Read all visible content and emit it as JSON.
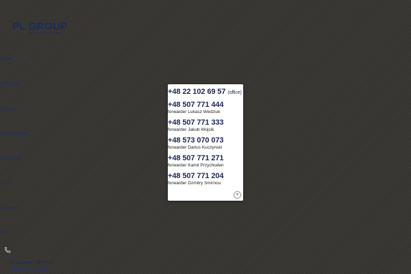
{
  "logo": {
    "name": "PL GROUP",
    "tagline": "DELIVERY IN TIME"
  },
  "nav": [
    {
      "label": "Home"
    },
    {
      "label": "About us"
    },
    {
      "label": "Service"
    },
    {
      "label": "Fleet Vehicle"
    },
    {
      "label": "Calculator"
    },
    {
      "label": "Jobs"
    },
    {
      "label": "Contacts"
    },
    {
      "label": "ENG"
    }
  ],
  "connect": {
    "label": "TO CONNECT WITH US",
    "phone": "+48221026957"
  },
  "modal": {
    "contacts": [
      {
        "phone": "+48 22 102 69 57",
        "note": "(office)",
        "name": ""
      },
      {
        "phone": "+48 507 771 444",
        "note": "",
        "name": "forwarder Lukasz Wedziuk"
      },
      {
        "phone": "+48 507 771 333",
        "note": "",
        "name": "forwarder Jakub Wojcik"
      },
      {
        "phone": "+48 573 070 073",
        "note": "",
        "name": "forwarder Darius Kuczynski"
      },
      {
        "phone": "+48 507 771 271",
        "note": "",
        "name": "forwarder Kamil Przychoden"
      },
      {
        "phone": "+48 507 771 204",
        "note": "",
        "name": "forwarder Dzmitry Smirnou"
      }
    ],
    "close_symbol": "×"
  },
  "colors": {
    "background": "#373531",
    "navy": "#1b2659",
    "modal_bg": "#ffffff"
  },
  "icons": {
    "phone": "phone-icon",
    "close": "close-icon"
  }
}
